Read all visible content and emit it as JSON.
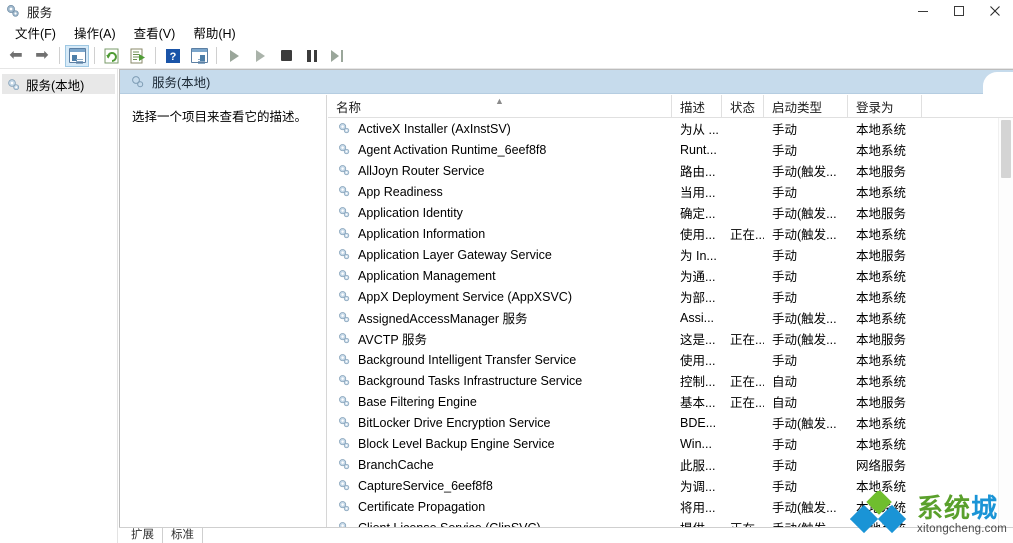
{
  "window": {
    "title": "服务",
    "icon": "services-gears-icon",
    "controls": [
      {
        "name": "minimize-button",
        "glyph": "–"
      },
      {
        "name": "maximize-button",
        "glyph": "▢"
      },
      {
        "name": "close-button",
        "glyph": "✕"
      }
    ]
  },
  "menubar": {
    "items": [
      {
        "label": "文件(F)"
      },
      {
        "label": "操作(A)"
      },
      {
        "label": "查看(V)"
      },
      {
        "label": "帮助(H)"
      }
    ]
  },
  "toolbar": {
    "buttons": [
      {
        "name": "back-button",
        "icon": "arrow-left-icon"
      },
      {
        "name": "forward-button",
        "icon": "arrow-right-icon"
      },
      {
        "name": "show-hide-console-tree-button",
        "icon": "console-tree-icon",
        "selected": true
      },
      {
        "name": "refresh-button",
        "icon": "refresh-icon"
      },
      {
        "name": "export-list-button",
        "icon": "export-list-icon"
      },
      {
        "name": "help-button",
        "icon": "help-question-icon"
      },
      {
        "name": "show-action-pane-button",
        "icon": "action-pane-icon"
      },
      {
        "name": "start-service-button",
        "icon": "play-icon"
      },
      {
        "name": "resume-service-button",
        "icon": "play-outline-icon"
      },
      {
        "name": "stop-service-button",
        "icon": "stop-icon"
      },
      {
        "name": "pause-service-button",
        "icon": "pause-icon"
      },
      {
        "name": "restart-service-button",
        "icon": "restart-icon"
      }
    ]
  },
  "tree": {
    "items": [
      {
        "label": "服务(本地)",
        "icon": "gear-icon",
        "selected": true
      }
    ]
  },
  "pane": {
    "header_title": "服务(本地)",
    "header_icon": "gear-icon",
    "header_bg": "#c6dbec",
    "description_placeholder": "选择一个项目来查看它的描述。"
  },
  "list": {
    "columns": [
      {
        "key": "name",
        "label": "名称",
        "sorted": "asc",
        "sort_caret": "︿"
      },
      {
        "key": "desc",
        "label": "描述"
      },
      {
        "key": "stat",
        "label": "状态"
      },
      {
        "key": "start",
        "label": "启动类型"
      },
      {
        "key": "logon",
        "label": "登录为"
      }
    ],
    "rows": [
      {
        "name": "ActiveX Installer (AxInstSV)",
        "desc": "为从 ...",
        "stat": "",
        "start": "手动",
        "logon": "本地系统"
      },
      {
        "name": "Agent Activation Runtime_6eef8f8",
        "desc": "Runt...",
        "stat": "",
        "start": "手动",
        "logon": "本地系统"
      },
      {
        "name": "AllJoyn Router Service",
        "desc": "路由...",
        "stat": "",
        "start": "手动(触发...",
        "logon": "本地服务"
      },
      {
        "name": "App Readiness",
        "desc": "当用...",
        "stat": "",
        "start": "手动",
        "logon": "本地系统"
      },
      {
        "name": "Application Identity",
        "desc": "确定...",
        "stat": "",
        "start": "手动(触发...",
        "logon": "本地服务"
      },
      {
        "name": "Application Information",
        "desc": "使用...",
        "stat": "正在...",
        "start": "手动(触发...",
        "logon": "本地系统"
      },
      {
        "name": "Application Layer Gateway Service",
        "desc": "为 In...",
        "stat": "",
        "start": "手动",
        "logon": "本地服务"
      },
      {
        "name": "Application Management",
        "desc": "为通...",
        "stat": "",
        "start": "手动",
        "logon": "本地系统"
      },
      {
        "name": "AppX Deployment Service (AppXSVC)",
        "desc": "为部...",
        "stat": "",
        "start": "手动",
        "logon": "本地系统"
      },
      {
        "name": "AssignedAccessManager 服务",
        "desc": "Assi...",
        "stat": "",
        "start": "手动(触发...",
        "logon": "本地系统"
      },
      {
        "name": "AVCTP 服务",
        "desc": "这是...",
        "stat": "正在...",
        "start": "手动(触发...",
        "logon": "本地服务"
      },
      {
        "name": "Background Intelligent Transfer Service",
        "desc": "使用...",
        "stat": "",
        "start": "手动",
        "logon": "本地系统"
      },
      {
        "name": "Background Tasks Infrastructure Service",
        "desc": "控制...",
        "stat": "正在...",
        "start": "自动",
        "logon": "本地系统"
      },
      {
        "name": "Base Filtering Engine",
        "desc": "基本...",
        "stat": "正在...",
        "start": "自动",
        "logon": "本地服务"
      },
      {
        "name": "BitLocker Drive Encryption Service",
        "desc": "BDE...",
        "stat": "",
        "start": "手动(触发...",
        "logon": "本地系统"
      },
      {
        "name": "Block Level Backup Engine Service",
        "desc": "Win...",
        "stat": "",
        "start": "手动",
        "logon": "本地系统"
      },
      {
        "name": "BranchCache",
        "desc": "此服...",
        "stat": "",
        "start": "手动",
        "logon": "网络服务"
      },
      {
        "name": "CaptureService_6eef8f8",
        "desc": "为调...",
        "stat": "",
        "start": "手动",
        "logon": "本地系统"
      },
      {
        "name": "Certificate Propagation",
        "desc": "将用...",
        "stat": "",
        "start": "手动(触发...",
        "logon": "本地系统"
      },
      {
        "name": "Client License Service (ClipSVC)",
        "desc": "提供...",
        "stat": "正在...",
        "start": "手动(触发...",
        "logon": "本地系统"
      }
    ],
    "row_icon": "service-gear-icon"
  },
  "tabs": {
    "items": [
      {
        "label": "扩展"
      },
      {
        "label": "标准"
      }
    ]
  },
  "watermark": {
    "main_part1": "系统",
    "main_part2": "城",
    "sub": "xitongcheng.com",
    "color_green": "#5aa02c",
    "color_blue": "#1a94d6"
  }
}
